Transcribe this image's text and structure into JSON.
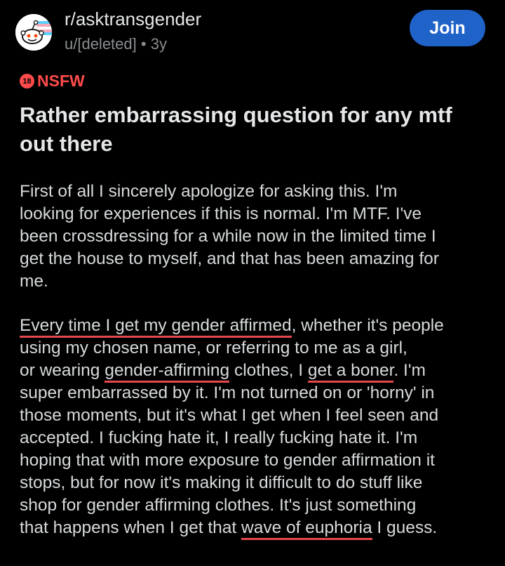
{
  "post": {
    "subreddit": "r/asktransgender",
    "author": "u/[deleted]",
    "separator": "•",
    "age": "3y",
    "join_label": "Join",
    "nsfw_badge": "18",
    "nsfw_label": "NSFW",
    "title": "Rather embarrassing question for any mtf out there"
  },
  "body": {
    "paragraph1_lines": [
      "First of all I sincerely apologize for asking this. I'm",
      "looking for experiences if this is normal. I'm MTF. I've",
      "been crossdressing for a while now in the limited time I",
      "get the house to myself, and that has been amazing for",
      "me."
    ],
    "paragraph2_lines": [
      [
        {
          "text": "Every time I get my gender affirmed",
          "highlight": true
        },
        {
          "text": ", whether it's people",
          "highlight": false
        }
      ],
      [
        {
          "text": "using my chosen name, or referring to me as a girl,",
          "highlight": false
        }
      ],
      [
        {
          "text": "or wearing ",
          "highlight": false
        },
        {
          "text": "gender-affirming",
          "highlight": true
        },
        {
          "text": " clothes, I ",
          "highlight": false
        },
        {
          "text": "get a boner",
          "highlight": true
        },
        {
          "text": ". I'm",
          "highlight": false
        }
      ],
      [
        {
          "text": "super embarrassed by it. I'm not turned on or 'horny' in",
          "highlight": false
        }
      ],
      [
        {
          "text": "those moments, but it's what I get when I feel seen and",
          "highlight": false
        }
      ],
      [
        {
          "text": "accepted. I fucking hate it, I really fucking hate it. I'm",
          "highlight": false
        }
      ],
      [
        {
          "text": "hoping that with more exposure to gender affirmation it",
          "highlight": false
        }
      ],
      [
        {
          "text": "stops, but for now it's making it difficult to do stuff like",
          "highlight": false
        }
      ],
      [
        {
          "text": "shop for gender affirming clothes. It's just something",
          "highlight": false
        }
      ],
      [
        {
          "text": "that happens when I get that ",
          "highlight": false
        },
        {
          "text": "wave of euphoria",
          "highlight": true
        },
        {
          "text": " I guess.",
          "highlight": false
        }
      ]
    ]
  },
  "colors": {
    "background": "#000000",
    "join_button": "#1f62c8",
    "nsfw": "#ff4b4b",
    "highlight_underline": "#e5484d",
    "meta_text": "#8a8d90"
  },
  "icons": {
    "subreddit_avatar": "snoo-avatar-icon",
    "nsfw": "nsfw-18-icon"
  }
}
